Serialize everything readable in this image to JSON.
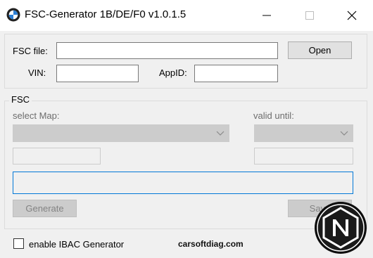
{
  "window": {
    "title": "FSC-Generator 1B/DE/F0 v1.0.1.5"
  },
  "top": {
    "fsc_file_label": "FSC file:",
    "fsc_file_value": "",
    "open_label": "Open",
    "vin_label": "VIN:",
    "vin_value": "",
    "appid_label": "AppID:",
    "appid_value": ""
  },
  "fsc": {
    "group_title": "FSC",
    "select_map_label": "select Map:",
    "select_map_value": "",
    "valid_until_label": "valid until:",
    "valid_until_value": "",
    "generate_label": "Generate",
    "save_label": "Save"
  },
  "footer": {
    "ibac_label": "enable IBAC Generator",
    "ibac_checked": false,
    "watermark": "carsoftdiag.com"
  },
  "icons": {
    "app": "app-logo-icon",
    "minimize": "minimize-icon",
    "maximize": "maximize-icon",
    "close": "close-icon",
    "dropdown": "chevron-down-icon",
    "brand": "brand-logo-icon"
  },
  "colors": {
    "focus_border": "#0078d7",
    "disabled_fill": "#cccccc"
  }
}
